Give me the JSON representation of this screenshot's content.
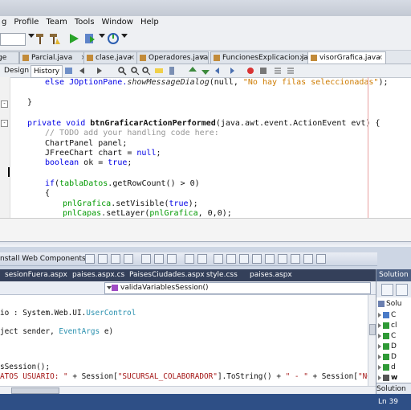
{
  "netbeans": {
    "menu": [
      "g",
      "Profile",
      "Team",
      "Tools",
      "Window",
      "Help"
    ],
    "tabs": [
      {
        "label": "ge"
      },
      {
        "label": "Parcial.java"
      },
      {
        "label": "clase.java"
      },
      {
        "label": "Operadores.java"
      },
      {
        "label": "FuncionesExplicacion.java"
      },
      {
        "label": "visorGrafica.java",
        "active": true
      }
    ],
    "modes": {
      "design": "Design",
      "history": "History"
    },
    "code": {
      "line1_call": "else JOptionPane.",
      "line1_method": "showMessageDialog",
      "line1_args": "(null, ",
      "line1_str": "\"No hay filas seleccionadas\"",
      "line1_end": ");",
      "line2": "}",
      "line3_kw": "private void ",
      "line3_name": "btnGraficarActionPerformed",
      "line3_args": "(java.awt.event.ActionEvent evt) {",
      "line4": "// TODO add your handling code here:",
      "line5": "ChartPanel panel;",
      "line6_a": "JFreeChart chart = ",
      "line6_kw": "null",
      "line6_b": ";",
      "line7_kw": "boolean ",
      "line7_a": "ok = ",
      "line7_kw2": "true",
      "line7_b": ";",
      "line8_kw": "if",
      "line8_a": "(",
      "line8_fld": "tablaDatos",
      "line8_b": ".getRowCount() > 0)",
      "line9": "{",
      "line10_fld": "pnlGrafica",
      "line10_a": ".setVisible(",
      "line10_kw": "true",
      "line10_b": ");",
      "line11_fld": "pnlCapas",
      "line11_a": ".setLayer(",
      "line11_fld2": "pnlGrafica",
      "line11_b": ", 0,0);"
    }
  },
  "visualstudio": {
    "toolbar_label": "nstall Web Components",
    "tabs": [
      "sesionFuera.aspx",
      "paises.aspx.cs",
      "PaisesCiudades.aspx",
      "style.css",
      "paises.aspx"
    ],
    "member_dropdown": "validaVariablesSession()",
    "code": {
      "l1_a": "io : System.Web.UI.",
      "l1_ty": "UserControl",
      "l2_a": "ject sender, ",
      "l2_ty": "EventArgs",
      "l2_b": " e)",
      "l3": "sSession();",
      "l4_str": "ATOS USUARIO: \"",
      "l4_a": " + Session[",
      "l4_str2": "\"SUCURSAL_COLABORADOR\"",
      "l4_b": "].ToString() + ",
      "l4_str3": "\" - \"",
      "l4_c": " + Session[",
      "l4_str4": "\"NOMBRE_COLABC"
    },
    "solution_explorer": {
      "title": "Solution Ex",
      "root": "Solu",
      "items": [
        {
          "label": "C",
          "color": "#4a7bc7"
        },
        {
          "label": "cl",
          "color": "#2f9a36"
        },
        {
          "label": "C",
          "color": "#2f9a36"
        },
        {
          "label": "D",
          "color": "#2f9a36"
        },
        {
          "label": "D",
          "color": "#2f9a36"
        },
        {
          "label": "d",
          "color": "#2f9a36"
        },
        {
          "label": "w",
          "color": "#555555"
        }
      ],
      "footer": "Solution"
    },
    "status": {
      "line": "Ln 39"
    }
  }
}
